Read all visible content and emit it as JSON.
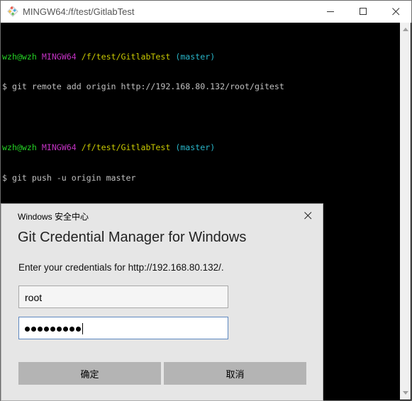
{
  "window": {
    "title": "MINGW64:/f/test/GitlabTest"
  },
  "terminal": {
    "prompt1": {
      "user": "wzh@wzh",
      "host": "MINGW64",
      "path": "/f/test/GitlabTest",
      "branch": "(master)"
    },
    "command1": "$ git remote add origin http://192.168.80.132/root/gitest",
    "prompt2": {
      "user": "wzh@wzh",
      "host": "MINGW64",
      "path": "/f/test/GitlabTest",
      "branch": "(master)"
    },
    "command2": "$ git push -u origin master"
  },
  "dialog": {
    "header": "Windows 安全中心",
    "title": "Git Credential Manager for Windows",
    "prompt": "Enter your credentials for http://192.168.80.132/.",
    "username_value": "root",
    "password_length": 9,
    "ok_label": "确定",
    "cancel_label": "取消"
  },
  "colors": {
    "user": "#24d024",
    "host": "#c232c2",
    "path": "#c8c800",
    "branch": "#29b6c9"
  }
}
